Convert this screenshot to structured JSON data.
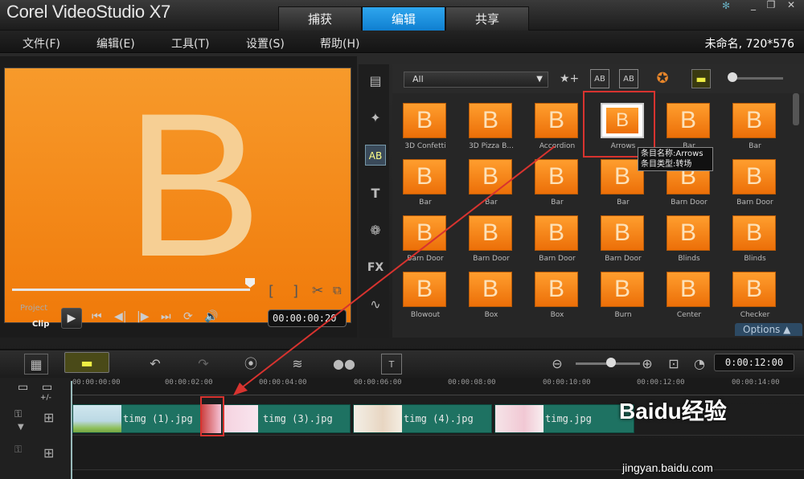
{
  "app": {
    "title": "Corel VideoStudio X7",
    "project_info": "未命名, 720*576"
  },
  "tabs": [
    {
      "label": "捕获"
    },
    {
      "label": "编辑"
    },
    {
      "label": "共享"
    }
  ],
  "menu": [
    {
      "label": "文件(F)"
    },
    {
      "label": "编辑(E)"
    },
    {
      "label": "工具(T)"
    },
    {
      "label": "设置(S)"
    },
    {
      "label": "帮助(H)"
    }
  ],
  "preview": {
    "letter": "B",
    "mode_project": "Project",
    "mode_clip": "Clip",
    "timecode": "00:00:00:20",
    "bracket_in": "[",
    "bracket_out": "]"
  },
  "library": {
    "filter": "All",
    "items": [
      {
        "label": "3D Confetti"
      },
      {
        "label": "3D Pizza B..."
      },
      {
        "label": "Accordion"
      },
      {
        "label": "Arrows"
      },
      {
        "label": "Bar"
      },
      {
        "label": "Bar"
      },
      {
        "label": "Bar"
      },
      {
        "label": "Bar"
      },
      {
        "label": "Bar"
      },
      {
        "label": "Bar"
      },
      {
        "label": "Barn Door"
      },
      {
        "label": "Barn Door"
      },
      {
        "label": "Barn Door"
      },
      {
        "label": "Barn Door"
      },
      {
        "label": "Barn Door"
      },
      {
        "label": "Barn Door"
      },
      {
        "label": "Blinds"
      },
      {
        "label": "Blinds"
      },
      {
        "label": "Blowout"
      },
      {
        "label": "Box"
      },
      {
        "label": "Box"
      },
      {
        "label": "Burn"
      },
      {
        "label": "Center"
      },
      {
        "label": "Checker"
      }
    ],
    "thumb_letter": "B",
    "tooltip": {
      "name": "条目名称:Arrows",
      "type": "条目类型:转场"
    },
    "options_label": "Options"
  },
  "timeline": {
    "timecode": "0:00:12:00",
    "ticks": [
      "00:00:00:00",
      "00:00:02:00",
      "00:00:04:00",
      "00:00:06:00",
      "00:00:08:00",
      "00:00:10:00",
      "00:00:12:00",
      "00:00:14:00"
    ],
    "clips": [
      {
        "label": "timg (1).jpg"
      },
      {
        "label": "timg (3).jpg"
      },
      {
        "label": "timg (4).jpg"
      },
      {
        "label": "timg.jpg"
      }
    ]
  },
  "watermark": {
    "logo": "Baidu经验",
    "url": "jingyan.baidu.com"
  }
}
